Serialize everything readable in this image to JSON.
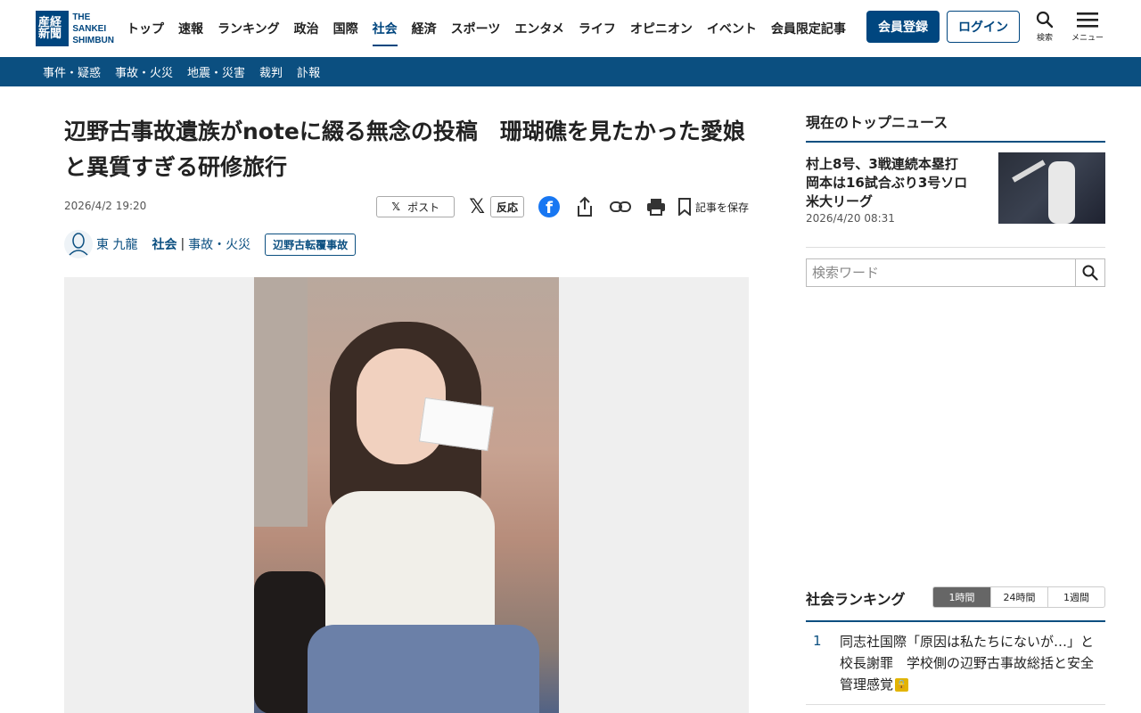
{
  "header": {
    "logo_mark": "産経新聞",
    "logo_line1": "THE",
    "logo_line2": "SANKEI",
    "logo_line3": "SHIMBUN",
    "nav": [
      "トップ",
      "速報",
      "ランキング",
      "政治",
      "国際",
      "社会",
      "経済",
      "スポーツ",
      "エンタメ",
      "ライフ",
      "オピニオン",
      "イベント",
      "会員限定記事"
    ],
    "active_nav": "社会",
    "register_label": "会員登録",
    "login_label": "ログイン",
    "search_label": "検索",
    "menu_label": "メニュー"
  },
  "subnav": [
    "事件・疑惑",
    "事故・火災",
    "地震・災害",
    "裁判",
    "訃報"
  ],
  "article": {
    "title": "辺野古事故遺族がnoteに綴る無念の投稿　珊瑚礁を見たかった愛娘と異質すぎる研修旅行",
    "date": "2026/4/2 19:20",
    "post_label": "ポスト",
    "reaction_label": "反応",
    "save_label": "記事を保存",
    "author": "東 九龍",
    "category": "社会",
    "subcategory": "事故・火災",
    "tag": "辺野古転覆事故"
  },
  "sidebar": {
    "top_news_heading": "現在のトップニュース",
    "top_news": {
      "title": "村上8号、3戦連続本塁打　岡本は16試合ぶり3号ソロ　米大リーグ",
      "date": "2026/4/20 08:31"
    },
    "search_placeholder": "検索ワード",
    "ranking_heading": "社会ランキング",
    "ranking_tabs": [
      "1時間",
      "24時間",
      "1週間"
    ],
    "ranking_active": "1時間",
    "ranking": [
      {
        "rank": "1",
        "title": "同志社国際「原因は私たちにないが…」と校長謝罪　学校側の辺野古事故総括と安全管理感覚"
      }
    ]
  },
  "colors": {
    "brand": "#00467f",
    "subnav_bg": "#0b4f80",
    "facebook": "#1877f2",
    "lock_badge": "#e2b400"
  }
}
